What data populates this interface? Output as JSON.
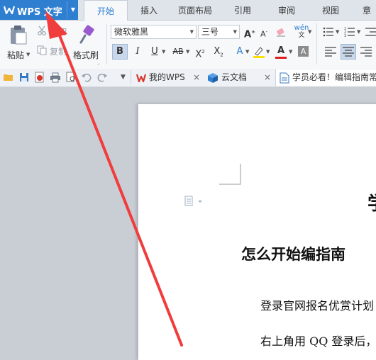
{
  "app": {
    "title": "WPS 文字"
  },
  "tabs": [
    {
      "label": "开始",
      "active": true
    },
    {
      "label": "插入"
    },
    {
      "label": "页面布局"
    },
    {
      "label": "引用"
    },
    {
      "label": "审阅"
    },
    {
      "label": "视图"
    },
    {
      "label": "章"
    }
  ],
  "ribbon": {
    "paste_label": "粘贴",
    "cut_label": "剪切",
    "copy_label": "复制",
    "format_painter_label": "格式刷",
    "font_name": "微软雅黑",
    "font_size": "三号"
  },
  "doc_tabs": [
    {
      "label": "我的WPS"
    },
    {
      "label": "云文档"
    },
    {
      "label": "学员必看！编辑指南常"
    }
  ],
  "document": {
    "heading_partial": "学",
    "section_heading": "怎么开始编指南",
    "paragraph_1": "登录官网报名优赏计划",
    "paragraph_2": "右上角用 QQ 登录后，"
  },
  "colors": {
    "accent": "#2f7fd1",
    "arrow": "#f03c3c",
    "wps_red": "#d9352b"
  }
}
